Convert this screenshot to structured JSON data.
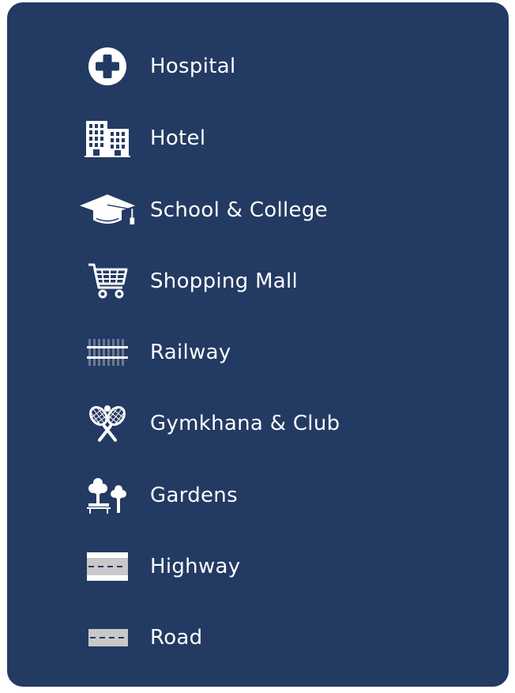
{
  "legend": {
    "items": [
      {
        "label": "Hospital",
        "icon": "hospital-cross-icon"
      },
      {
        "label": "Hotel",
        "icon": "hotel-building-icon"
      },
      {
        "label": "School & College",
        "icon": "graduation-cap-icon"
      },
      {
        "label": "Shopping Mall",
        "icon": "shopping-cart-icon"
      },
      {
        "label": "Railway",
        "icon": "railway-track-icon"
      },
      {
        "label": "Gymkhana & Club",
        "icon": "tennis-rackets-icon"
      },
      {
        "label": "Gardens",
        "icon": "garden-trees-bench-icon"
      },
      {
        "label": "Highway",
        "icon": "highway-icon"
      },
      {
        "label": "Road",
        "icon": "road-icon"
      }
    ]
  },
  "colors": {
    "panel_background": "#233a63",
    "panel_border": "#ffffff",
    "text": "#ffffff",
    "road_grey": "#c8c8c8"
  }
}
